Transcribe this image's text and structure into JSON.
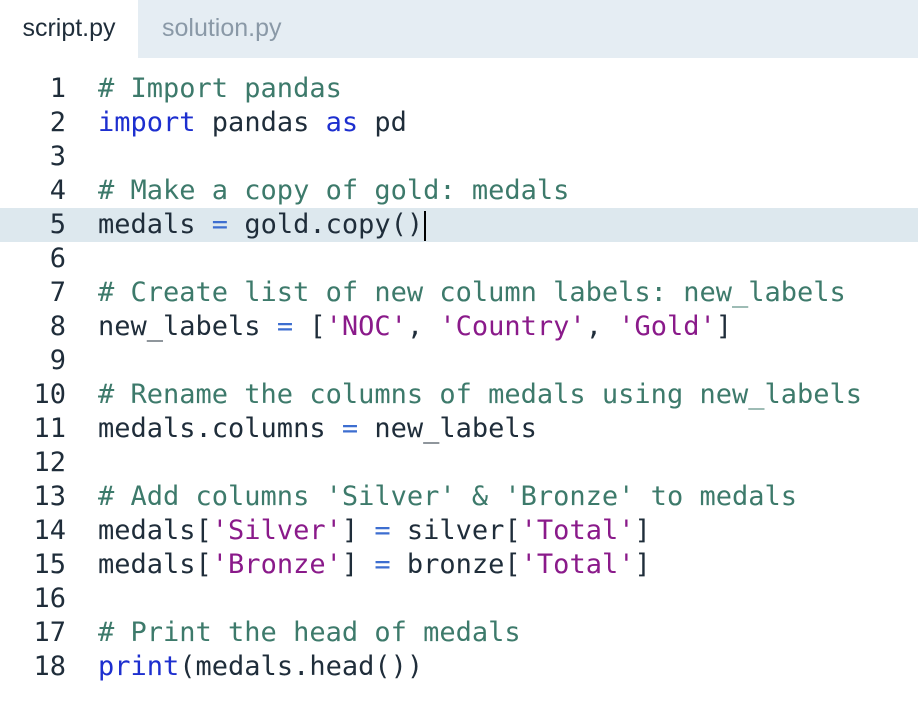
{
  "tabs": [
    {
      "label": "script.py",
      "active": true
    },
    {
      "label": "solution.py",
      "active": false
    }
  ],
  "editor": {
    "current_line": 5,
    "lines": [
      {
        "number": "1",
        "tokens": [
          {
            "type": "comment",
            "text": "# Import pandas"
          }
        ]
      },
      {
        "number": "2",
        "tokens": [
          {
            "type": "keyword",
            "text": "import"
          },
          {
            "type": "plain",
            "text": " pandas "
          },
          {
            "type": "keyword",
            "text": "as"
          },
          {
            "type": "plain",
            "text": " pd"
          }
        ]
      },
      {
        "number": "3",
        "tokens": []
      },
      {
        "number": "4",
        "tokens": [
          {
            "type": "comment",
            "text": "# Make a copy of gold: medals"
          }
        ]
      },
      {
        "number": "5",
        "tokens": [
          {
            "type": "plain",
            "text": "medals "
          },
          {
            "type": "op",
            "text": "="
          },
          {
            "type": "plain",
            "text": " gold.copy()"
          }
        ]
      },
      {
        "number": "6",
        "tokens": []
      },
      {
        "number": "7",
        "tokens": [
          {
            "type": "comment",
            "text": "# Create list of new column labels: new_labels"
          }
        ]
      },
      {
        "number": "8",
        "tokens": [
          {
            "type": "plain",
            "text": "new_labels "
          },
          {
            "type": "op",
            "text": "="
          },
          {
            "type": "plain",
            "text": " ["
          },
          {
            "type": "string",
            "text": "'NOC'"
          },
          {
            "type": "plain",
            "text": ", "
          },
          {
            "type": "string",
            "text": "'Country'"
          },
          {
            "type": "plain",
            "text": ", "
          },
          {
            "type": "string",
            "text": "'Gold'"
          },
          {
            "type": "plain",
            "text": "]"
          }
        ]
      },
      {
        "number": "9",
        "tokens": []
      },
      {
        "number": "10",
        "tokens": [
          {
            "type": "comment",
            "text": "# Rename the columns of medals using new_labels"
          }
        ]
      },
      {
        "number": "11",
        "tokens": [
          {
            "type": "plain",
            "text": "medals.columns "
          },
          {
            "type": "op",
            "text": "="
          },
          {
            "type": "plain",
            "text": " new_labels"
          }
        ]
      },
      {
        "number": "12",
        "tokens": []
      },
      {
        "number": "13",
        "tokens": [
          {
            "type": "comment",
            "text": "# Add columns 'Silver' & 'Bronze' to medals"
          }
        ]
      },
      {
        "number": "14",
        "tokens": [
          {
            "type": "plain",
            "text": "medals["
          },
          {
            "type": "string",
            "text": "'Silver'"
          },
          {
            "type": "plain",
            "text": "] "
          },
          {
            "type": "op",
            "text": "="
          },
          {
            "type": "plain",
            "text": " silver["
          },
          {
            "type": "string",
            "text": "'Total'"
          },
          {
            "type": "plain",
            "text": "]"
          }
        ]
      },
      {
        "number": "15",
        "tokens": [
          {
            "type": "plain",
            "text": "medals["
          },
          {
            "type": "string",
            "text": "'Bronze'"
          },
          {
            "type": "plain",
            "text": "] "
          },
          {
            "type": "op",
            "text": "="
          },
          {
            "type": "plain",
            "text": " bronze["
          },
          {
            "type": "string",
            "text": "'Total'"
          },
          {
            "type": "plain",
            "text": "]"
          }
        ]
      },
      {
        "number": "16",
        "tokens": []
      },
      {
        "number": "17",
        "tokens": [
          {
            "type": "comment",
            "text": "# Print the head of medals"
          }
        ]
      },
      {
        "number": "18",
        "tokens": [
          {
            "type": "keyword",
            "text": "print"
          },
          {
            "type": "plain",
            "text": "(medals.head())"
          }
        ]
      }
    ]
  },
  "colors": {
    "tabbar_background": "#e5edf3",
    "current_line_highlight": "#dde8ee",
    "comment": "#3d7a6b",
    "keyword": "#1d2fcf",
    "string": "#8a1a8a",
    "operator": "#3d6ed0",
    "text": "#1f2d3a"
  }
}
